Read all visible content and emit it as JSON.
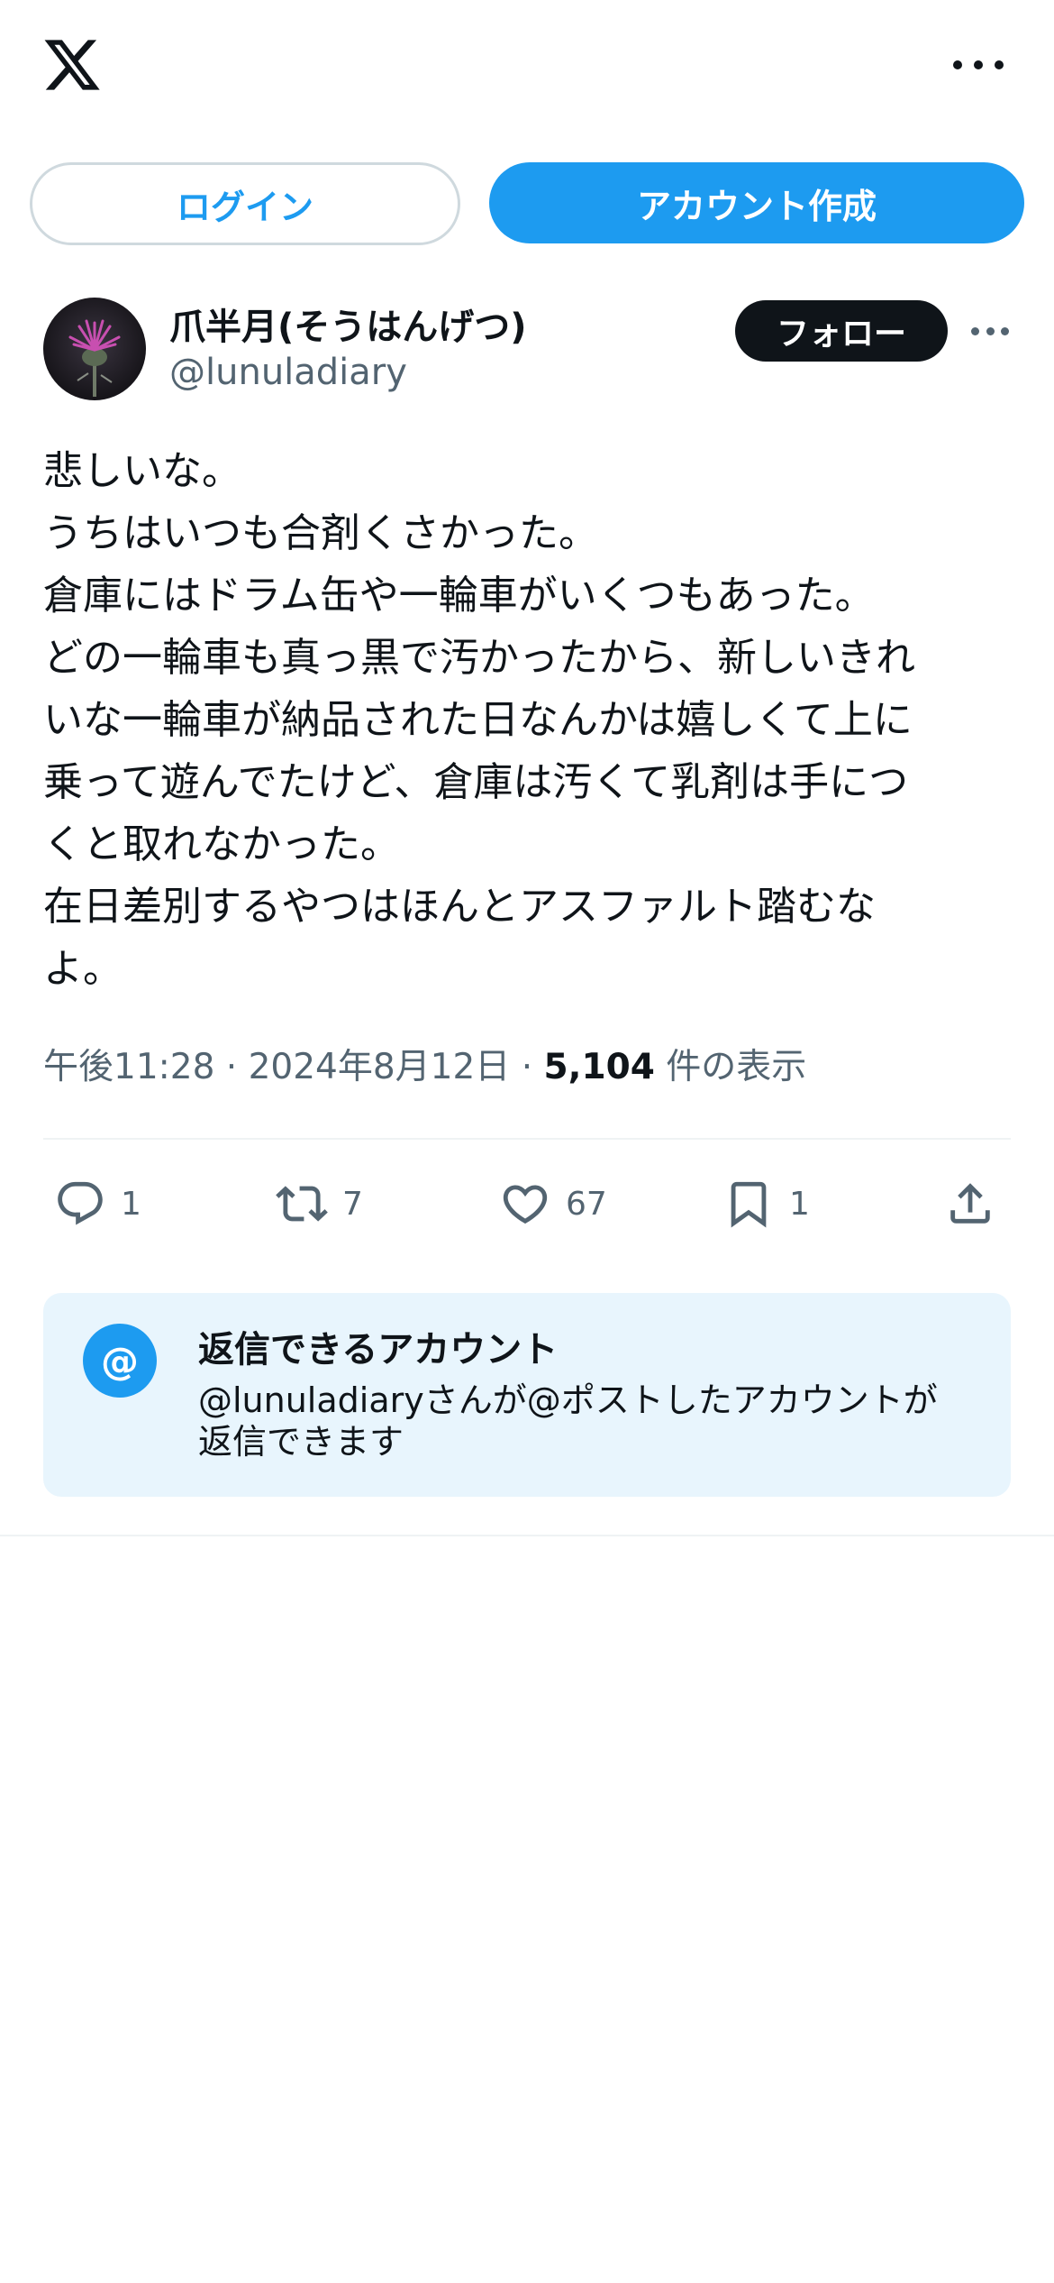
{
  "topbar": {
    "logo_icon": "x-logo-icon",
    "more_icon": "more-horizontal-icon"
  },
  "auth": {
    "login_label": "ログイン",
    "signup_label": "アカウント作成"
  },
  "post": {
    "author": {
      "display_name": "爪半月(そうはんげつ)",
      "handle": "@lunuladiary",
      "avatar": "thistle-flower-avatar"
    },
    "follow_label": "フォロー",
    "text_lines": [
      "悲しいな。",
      "うちはいつも合剤くさかった。",
      "倉庫にはドラム缶や一輪車がいくつもあった。",
      "どの一輪車も真っ黒で汚かったから、新しいきれ",
      "いな一輪車が納品された日なんかは嬉しくて上に",
      "乗って遊んでたけど、倉庫は汚くて乳剤は手につ",
      "くと取れなかった。",
      "在日差別するやつはほんとアスファルト踏むな",
      "よ。"
    ],
    "meta": {
      "time": "午後11:28",
      "sep1": " · ",
      "date": "2024年8月12日",
      "sep2": " · ",
      "views": "5,104",
      "views_label": " 件の表示"
    },
    "actions": {
      "reply": {
        "icon": "reply-icon",
        "count": "1"
      },
      "repost": {
        "icon": "repost-icon",
        "count": "7"
      },
      "like": {
        "icon": "heart-icon",
        "count": "67"
      },
      "bookmark": {
        "icon": "bookmark-icon",
        "count": "1"
      },
      "share": {
        "icon": "share-icon"
      }
    }
  },
  "reply_restriction": {
    "icon": "at-icon",
    "badge": "@",
    "title": "返信できるアカウント",
    "desc_line1": "@lunuladiaryさんが@ポストしたアカウントが",
    "desc_line2": "返信できます"
  },
  "colors": {
    "accent": "#1d9bf0",
    "text": "#0f1419",
    "muted": "#536471",
    "card_bg": "#e8f5fd",
    "follow_bg": "#0f1419"
  }
}
